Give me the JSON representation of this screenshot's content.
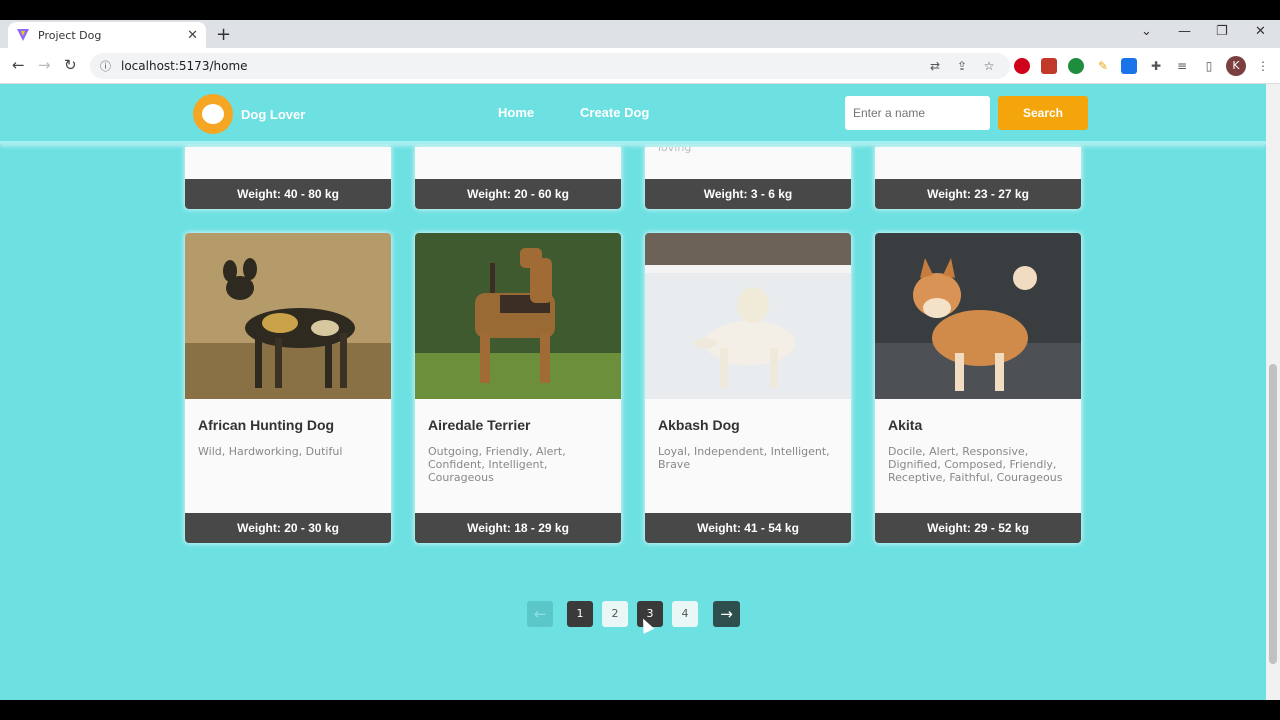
{
  "browser": {
    "tab_title": "Project Dog",
    "url": "localhost:5173/home",
    "avatar_letter": "K"
  },
  "navbar": {
    "brand": "Dog Lover",
    "links": [
      "Home",
      "Create Dog"
    ],
    "search_placeholder": "Enter a name",
    "search_button": "Search"
  },
  "top_row": [
    {
      "weight": "Weight: 40 - 80 kg"
    },
    {
      "weight": "Weight: 20 - 60 kg"
    },
    {
      "weight": "Weight: 3 - 6 kg",
      "partial_text": "loving"
    },
    {
      "weight": "Weight: 23 - 27 kg"
    }
  ],
  "cards": [
    {
      "name": "African Hunting Dog",
      "temperament": "Wild, Hardworking, Dutiful",
      "weight": "Weight: 20 - 30 kg"
    },
    {
      "name": "Airedale Terrier",
      "temperament": "Outgoing, Friendly, Alert, Confident, Intelligent, Courageous",
      "weight": "Weight: 18 - 29 kg"
    },
    {
      "name": "Akbash Dog",
      "temperament": "Loyal, Independent, Intelligent, Brave",
      "weight": "Weight: 41 - 54 kg"
    },
    {
      "name": "Akita",
      "temperament": "Docile, Alert, Responsive, Dignified, Composed, Friendly, Receptive, Faithful, Courageous",
      "weight": "Weight: 29 - 52 kg"
    }
  ],
  "pagination": {
    "pages": [
      "1",
      "2",
      "3",
      "4"
    ],
    "current": "3",
    "prev_icon": "arrow-left-icon",
    "next_icon": "arrow-right-icon"
  },
  "colors": {
    "page_bg": "#6de0e2",
    "accent": "#f5a50c",
    "dark": "#484848"
  }
}
